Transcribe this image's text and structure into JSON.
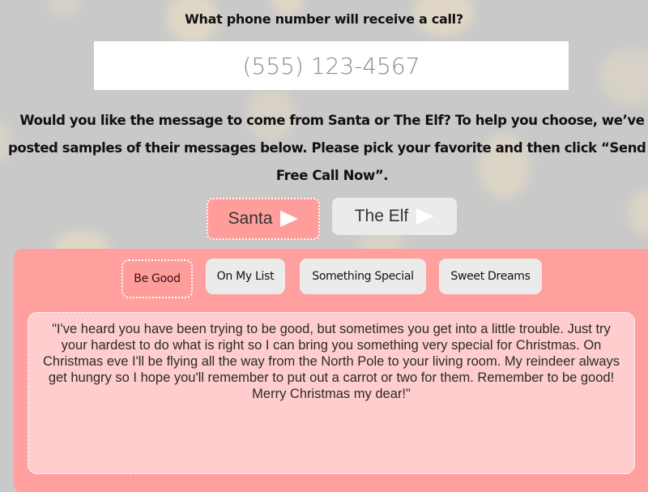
{
  "phone_section": {
    "question": "What phone number will receive a call?",
    "phone_placeholder": "(555) 123-4567",
    "phone_value": ""
  },
  "voice_section": {
    "instructions_line1": "Would you like the message to come from Santa or The Elf? To help you choose, we’ve",
    "instructions_line2": "posted samples of their messages below. Please pick your favorite and then click “Send a",
    "instructions_line3": "Free Call Now”.",
    "options": [
      {
        "label": "Santa",
        "icon": "play-icon",
        "selected": true
      },
      {
        "label": "The Elf",
        "icon": "play-icon",
        "selected": false
      }
    ]
  },
  "message_panel": {
    "tabs": [
      {
        "label": "Be Good",
        "active": true
      },
      {
        "label": "On My List",
        "active": false
      },
      {
        "label": "Something Special",
        "active": false
      },
      {
        "label": "Sweet Dreams",
        "active": false
      }
    ],
    "message_text": "\"I've heard you have been trying to be good, but sometimes you get into a little trouble. Just try your hardest to do what is right so I can bring you something very special for Christmas. On Christmas eve I'll be flying all the way from the North Pole to your living room. My reindeer always get hungry so I hope you'll remember to put out a carrot or two for them. Remember to be good! Merry Christmas my dear!\""
  },
  "colors": {
    "background": "#c9c9c9",
    "accent_pink": "#ffa09e",
    "selected_pink": "#ff9d9b",
    "message_bg": "#ffcdcd",
    "inactive_button": "#ebebeb"
  }
}
